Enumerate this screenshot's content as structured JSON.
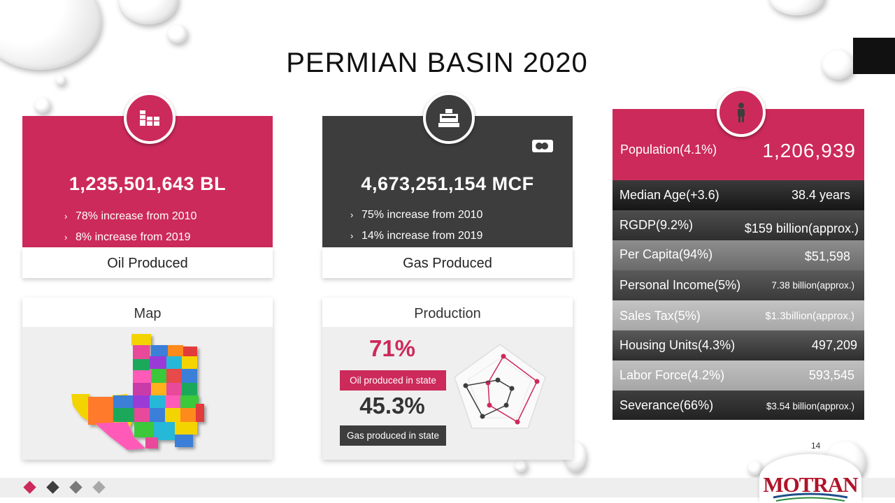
{
  "slide": {
    "title": "PERMIAN BASIN 2020",
    "page_number": "14",
    "logo_text": "MOTRAN"
  },
  "oil_card": {
    "icon": "oil-barrels-icon",
    "value": "1,235,501,643 BL",
    "bullets": [
      "78% increase from 2010",
      "8% increase from 2019"
    ],
    "label": "Oil Produced",
    "color": "#cc2a5a"
  },
  "gas_card": {
    "icon": "gas-pump-icon",
    "value": "4,673,251,154 MCF",
    "bullets": [
      "75% increase from 2010",
      "14% increase from 2019"
    ],
    "label": "Gas Produced",
    "color": "#3d3d3d"
  },
  "map_panel": {
    "title": "Map"
  },
  "production_panel": {
    "title": "Production",
    "oil_percent": "71%",
    "oil_label": "Oil produced in state",
    "gas_percent": "45.3%",
    "gas_label": "Gas produced in state"
  },
  "population": {
    "icon": "person-icon",
    "label": "Population(4.1%)",
    "value": "1,206,939"
  },
  "stats": [
    {
      "label": "Median Age(+3.6)",
      "value": "38.4 years"
    },
    {
      "label": "RGDP(9.2%)",
      "value": "$159 billion(approx.)"
    },
    {
      "label": "Per Capita(94%)",
      "value": "$51,598"
    },
    {
      "label": "Personal Income(5%)",
      "value": "7.38 billion(approx.)"
    },
    {
      "label": "Sales Tax(5%)",
      "value": "$1.3billion(approx.)"
    },
    {
      "label": "Housing Units(4.3%)",
      "value": "497,209"
    },
    {
      "label": "Labor Force(4.2%)",
      "value": "593,545"
    },
    {
      "label": "Severance(66%)",
      "value": "$3.54 billion(approx.)"
    }
  ],
  "colors": {
    "accent": "#cc2a5a",
    "dark": "#3d3d3d"
  }
}
